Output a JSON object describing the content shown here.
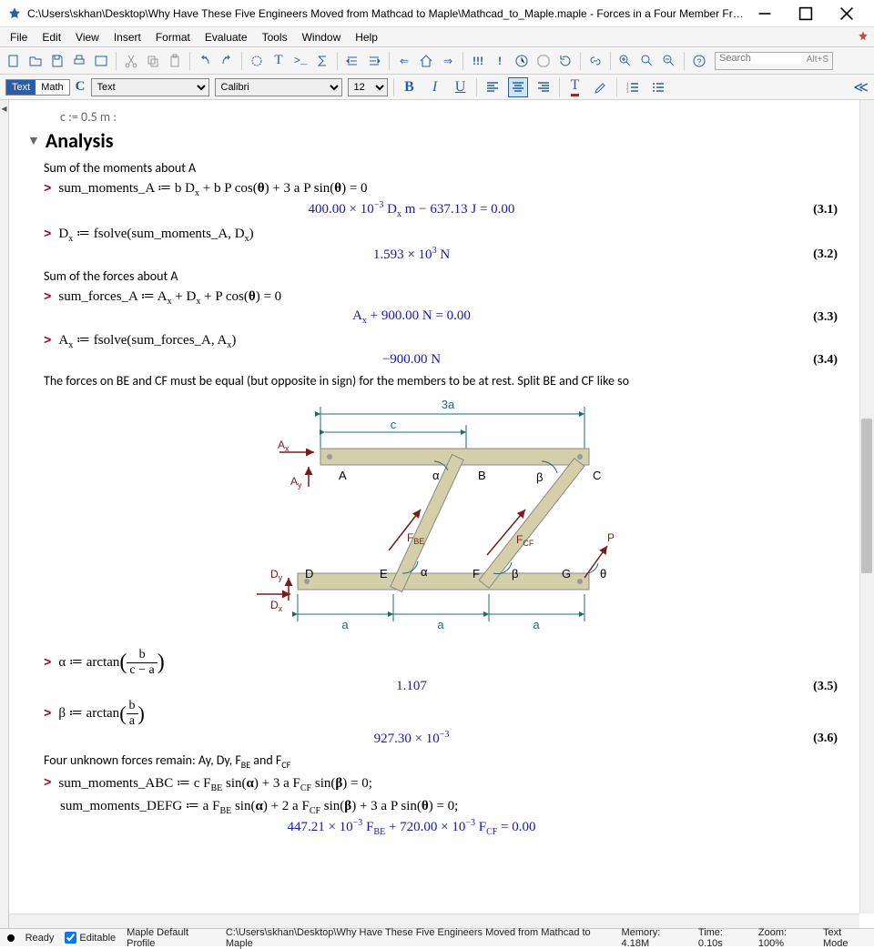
{
  "window": {
    "title": "C:\\Users\\skhan\\Desktop\\Why Have These Five Engineers Moved from Mathcad to Maple\\Mathcad_to_Maple.maple - Forces in a Four Member Fra..."
  },
  "menu": {
    "items": [
      "File",
      "Edit",
      "View",
      "Insert",
      "Format",
      "Evaluate",
      "Tools",
      "Window",
      "Help"
    ]
  },
  "search": {
    "placeholder": "Search",
    "shortcut": "Alt+S"
  },
  "ctx": {
    "mode_text": "Text",
    "mode_math": "Math",
    "style_label": "C",
    "style": "Text",
    "font": "Calibri",
    "size": "12"
  },
  "doc": {
    "section_title": "Analysis",
    "truncated_top": "c := 0.5 m :",
    "line1": "Sum of the moments about A",
    "p1_input": "sum_moments_A ≔ b Dₓ + b P cos(θ) + 3 a P sin(θ) = 0",
    "p1_output": "400.00 × 10⁻³ Dₓ m − 637.13 J = 0.00",
    "eq1": "(3.1)",
    "p2_input": "Dₓ ≔ fsolve(sum_moments_A, Dₓ)",
    "p2_output": "1.593 × 10³ N",
    "eq2": "(3.2)",
    "line2": "Sum of the forces about A",
    "p3_input": "sum_forces_A ≔ Aₓ + Dₓ + P cos(θ) = 0",
    "p3_output": "Aₓ + 900.00 N = 0.00",
    "eq3": "(3.3)",
    "p4_input": "Aₓ ≔ fsolve(sum_forces_A, Aₓ)",
    "p4_output": "−900.00 N",
    "eq4": "(3.4)",
    "line3": "The forces on BE and CF must be equal (but opposite in sign) for the members to be at rest.  Split BE and CF like so",
    "p5_pre": "α ≔ arctan",
    "p5_frac_num": "b",
    "p5_frac_den": "c − a",
    "p5_output": "1.107",
    "eq5": "(3.5)",
    "p6_pre": "β ≔ arctan",
    "p6_frac_num": "b",
    "p6_frac_den": "a",
    "p6_output": "927.30 × 10⁻³",
    "eq6": "(3.6)",
    "line4": "Four unknown forces remain: Ay, Dy, F_BE and F_CF",
    "p7_input": "sum_moments_ABC ≔ c F_BE sin(α) + 3 a F_CF sin(β) = 0;",
    "p8_input": "sum_moments_DEFG ≔ a F_BE sin(α) + 2 a F_CF sin(β) + 3 a P sin(θ) = 0;",
    "p7_output": "447.21 × 10⁻³ F_BE + 720.00 × 10⁻³ F_CF = 0.00",
    "diagram": {
      "labels": {
        "top_dim": "3a",
        "c_dim": "c",
        "Ax": "Aₓ",
        "Ay": "Aᵧ",
        "A": "A",
        "B": "B",
        "C": "C",
        "alpha": "α",
        "beta": "β",
        "FBE": "F_BE",
        "FCF": "F_CF",
        "P": "P",
        "Dy": "Dᵧ",
        "Dx": "Dₓ",
        "D": "D",
        "E": "E",
        "F": "F",
        "G": "G",
        "theta": "θ",
        "a": "a"
      }
    }
  },
  "status": {
    "ready": "Ready",
    "editable": "Editable",
    "profile": "Maple Default Profile",
    "path": "C:\\Users\\skhan\\Desktop\\Why Have These Five Engineers Moved from Mathcad to Maple",
    "memory": "Memory: 4.18M",
    "time": "Time: 0.10s",
    "zoom": "Zoom: 100%",
    "mode": "Text Mode"
  }
}
